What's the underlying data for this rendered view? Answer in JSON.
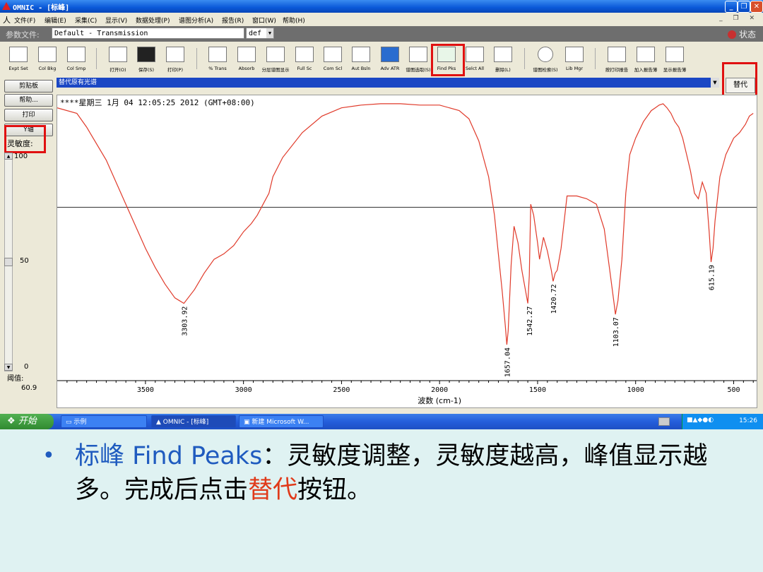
{
  "window": {
    "app_title": "OMNIC - [标峰]",
    "controls": [
      "_",
      "❐",
      "✕"
    ]
  },
  "menu": {
    "items": [
      "文件(F)",
      "编辑(E)",
      "采集(C)",
      "显示(V)",
      "数据处理(P)",
      "谱图分析(A)",
      "报告(R)",
      "窗口(W)",
      "帮助(H)"
    ],
    "mdi_controls": "_ ❐ ✕"
  },
  "params": {
    "label": "参数文件:",
    "file": "Default - Transmission",
    "select": "def",
    "status": "状态"
  },
  "toolbar": {
    "items": [
      "Expt Set",
      "Col Bkg",
      "Col Smp",
      "打开(O)",
      "保存(S)",
      "打印(P)",
      "% Trans",
      "Absorb",
      "分层谱图显示",
      "Full Sc",
      "Com Scl",
      "Aut Bsln",
      "Adv ATR",
      "谱图选取(S)",
      "Find Pks",
      "Selct All",
      "删除(L)",
      "谱图检索(S)",
      "Lib Mgr",
      "按打印报告",
      "加入报告薄",
      "显示报告薄"
    ]
  },
  "selection": {
    "text": "替代原有光谱",
    "replace_button": "替代"
  },
  "left_panel": {
    "buttons": [
      "剪贴板",
      "帮助...",
      "打印",
      "Y轴"
    ],
    "sensitivity_label": "灵敏度:",
    "slider_labels": [
      "100",
      "50",
      "0"
    ],
    "threshold_label": "阈值:",
    "threshold_value": "60.9",
    "sensitivity_level": 0.5
  },
  "chart_data": {
    "type": "line",
    "header": "****星期三 1月 04 12:05:25 2012 (GMT+08:00)",
    "xlabel": "波数 (cm-1)",
    "xlim": [
      3950,
      390
    ],
    "ylim": [
      0,
      100
    ],
    "xticks": [
      3500,
      3000,
      2500,
      2000,
      1500,
      1000,
      500
    ],
    "threshold": 60.9,
    "series": [
      {
        "color": "#e03a2a",
        "x": [
          3950,
          3850,
          3800,
          3700,
          3600,
          3500,
          3450,
          3400,
          3350,
          3303.92,
          3250,
          3200,
          3150,
          3100,
          3050,
          3000,
          2960,
          2930,
          2900,
          2870,
          2850,
          2800,
          2700,
          2600,
          2500,
          2400,
          2300,
          2200,
          2100,
          2000,
          1900,
          1850,
          1800,
          1750,
          1720,
          1700,
          1680,
          1665,
          1657.04,
          1650,
          1635,
          1620,
          1600,
          1580,
          1560,
          1550,
          1542.27,
          1535,
          1520,
          1500,
          1490,
          1470,
          1450,
          1430,
          1420.72,
          1410,
          1400,
          1380,
          1350,
          1300,
          1250,
          1200,
          1160,
          1130,
          1110,
          1103.07,
          1090,
          1070,
          1050,
          1030,
          1000,
          960,
          920,
          900,
          880,
          860,
          840,
          820,
          800,
          780,
          760,
          740,
          720,
          700,
          680,
          660,
          640,
          625,
          615.19,
          605,
          595,
          570,
          540,
          500,
          470,
          440,
          420,
          400
        ],
        "y": [
          97,
          95,
          90,
          78,
          62,
          46,
          39,
          33,
          28,
          26,
          31,
          37,
          42,
          44,
          47,
          52,
          55,
          58,
          62,
          66,
          72,
          79,
          88,
          94,
          97,
          98,
          98.5,
          98.5,
          98,
          98,
          96,
          93,
          85,
          72,
          58,
          44,
          30,
          18,
          11,
          16,
          40,
          54,
          48,
          38,
          30,
          26,
          36,
          62,
          58,
          48,
          42,
          50,
          45,
          38,
          34,
          37,
          38,
          46,
          65,
          65,
          64,
          62,
          53,
          37,
          26,
          22,
          27,
          42,
          66,
          80,
          86,
          92,
          96,
          97,
          98,
          98.5,
          97,
          95,
          92,
          90,
          86,
          80,
          74,
          66,
          64,
          70,
          66,
          52,
          41,
          46,
          56,
          72,
          80,
          86,
          88,
          91,
          94,
          95
        ]
      }
    ],
    "peaks": [
      {
        "x": 3303.92,
        "y": 26,
        "label": "3303.92"
      },
      {
        "x": 1657.04,
        "y": 11,
        "label": "1657.04"
      },
      {
        "x": 1542.27,
        "y": 26,
        "label": "1542.27"
      },
      {
        "x": 1420.72,
        "y": 34,
        "label": "1420.72"
      },
      {
        "x": 1103.07,
        "y": 22,
        "label": "1103.07"
      },
      {
        "x": 615.19,
        "y": 41,
        "label": "615.19"
      }
    ]
  },
  "taskbar": {
    "start": "开始",
    "buttons": [
      "示例",
      "OMNIC - [标峰]",
      "新建 Microsoft W..."
    ],
    "clock": "15:26"
  },
  "caption": {
    "bullet": "•",
    "part1": "标峰 Find Peaks",
    "part2": "：灵敏度调整，灵敏度越高，峰值显示越多。完成后点击",
    "part3": "替代",
    "part4": "按钮。"
  }
}
